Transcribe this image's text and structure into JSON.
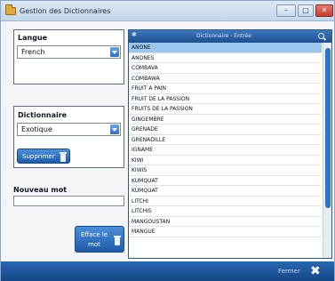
{
  "window": {
    "title": "Gestion des Dictionnaires",
    "controls": {
      "minimize": "–",
      "maximize": "□",
      "close": "✕"
    }
  },
  "langue": {
    "label": "Langue",
    "selected": "French"
  },
  "dictionnaire": {
    "label": "Dictionnaire",
    "selected": "Exotique",
    "delete_button": "Supprimer"
  },
  "nouveau_mot": {
    "label": "Nouveau mot",
    "value": "",
    "erase_button_line1": "Efface le",
    "erase_button_line2": "mot"
  },
  "list": {
    "header_icon": "✱",
    "header_title": "Dictionnaire - Entrée",
    "search_icon": "search-icon",
    "items": [
      "ANONE",
      "ANONES",
      "COMBAVA",
      "COMBAWA",
      "FRUIT A PAIN",
      "FRUIT DE LA PASSION",
      "FRUITS DE LA PASSION",
      "GINGEMBRE",
      "GRENADE",
      "GRENADILLE",
      "IGNAME",
      "KIWI",
      "KIWIS",
      "KUMQUAT",
      "KUMQUAT",
      "LITCHI",
      "LITCHIS",
      "MANGOUSTAN",
      "MANGUE"
    ],
    "selected_index": 0
  },
  "footer": {
    "close_label": "Fermer",
    "close_icon": "✖"
  },
  "colors": {
    "accent": "#1e5ba8",
    "header": "#1d4f8e",
    "selection": "#9cc6ee"
  }
}
